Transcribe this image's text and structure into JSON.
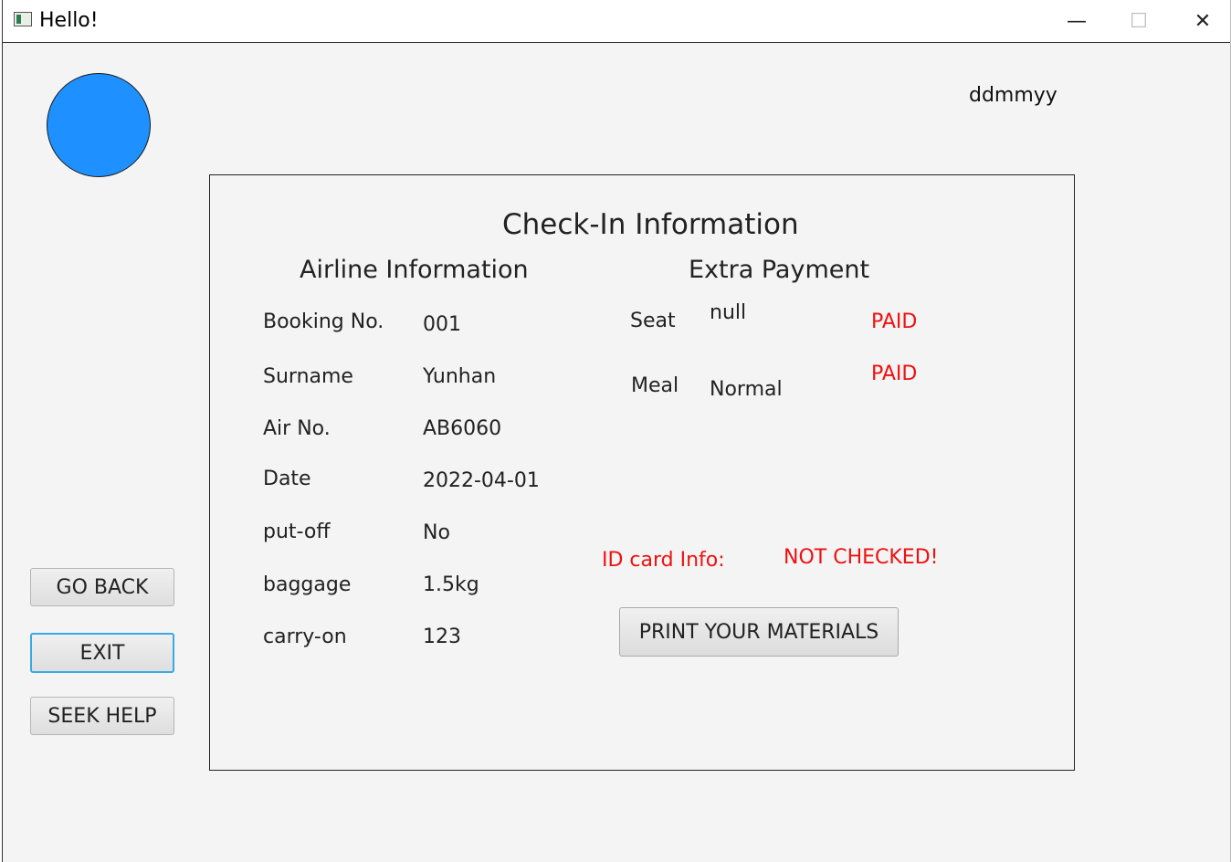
{
  "window": {
    "title": "Hello!",
    "min_glyph": "—",
    "max_glyph": "☐",
    "close_glyph": "✕"
  },
  "header": {
    "date_format": "ddmmyy"
  },
  "sidebar": {
    "go_back": "GO BACK",
    "exit": "EXIT",
    "seek_help": "SEEK HELP"
  },
  "checkin": {
    "title": "Check-In Information",
    "airline": {
      "heading": "Airline Information",
      "rows": [
        {
          "label": "Booking No.",
          "value": "001"
        },
        {
          "label": "Surname",
          "value": "Yunhan"
        },
        {
          "label": "Air No.",
          "value": "AB6060"
        },
        {
          "label": "Date",
          "value": "2022-04-01"
        },
        {
          "label": "put-off",
          "value": "No"
        },
        {
          "label": "baggage",
          "value": "1.5kg"
        },
        {
          "label": "carry-on",
          "value": "123"
        }
      ]
    },
    "extra": {
      "heading": "Extra Payment",
      "seat": {
        "label": "Seat",
        "value": "null",
        "status": "PAID"
      },
      "meal": {
        "label": "Meal",
        "value": "Normal",
        "status": "PAID"
      }
    },
    "id_card": {
      "label": "ID card Info:",
      "status": "NOT CHECKED!"
    },
    "print_button": "PRINT YOUR MATERIALS"
  },
  "colors": {
    "avatar": "#1e90ff",
    "status_red": "#ee1111",
    "focus_blue": "#39a9e6"
  }
}
